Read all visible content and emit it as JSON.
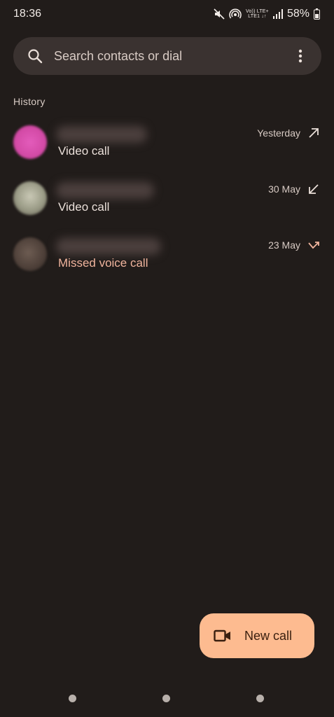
{
  "status_bar": {
    "time": "18:36",
    "network_top": "Vo)) LTE+",
    "network_bottom": "LTE1 ↓↑",
    "battery": "58%"
  },
  "search": {
    "placeholder": "Search contacts or dial"
  },
  "history": {
    "title": "History",
    "calls": [
      {
        "type": "Video call",
        "date": "Yesterday",
        "direction": "outgoing",
        "missed": false,
        "avatar_color": "#e052b5"
      },
      {
        "type": "Video call",
        "date": "30 May",
        "direction": "incoming",
        "missed": false,
        "avatar_color": "#a8a592"
      },
      {
        "type": "Missed voice call",
        "date": "23 May",
        "direction": "missed",
        "missed": true,
        "avatar_color": "#5b4a43"
      }
    ]
  },
  "fab": {
    "label": "New call",
    "icon": "video-camera-icon"
  },
  "colors": {
    "background": "#211c1a",
    "search_bg": "#3a3230",
    "fab_bg": "#fdbb90",
    "missed_text": "#f0b49d"
  }
}
